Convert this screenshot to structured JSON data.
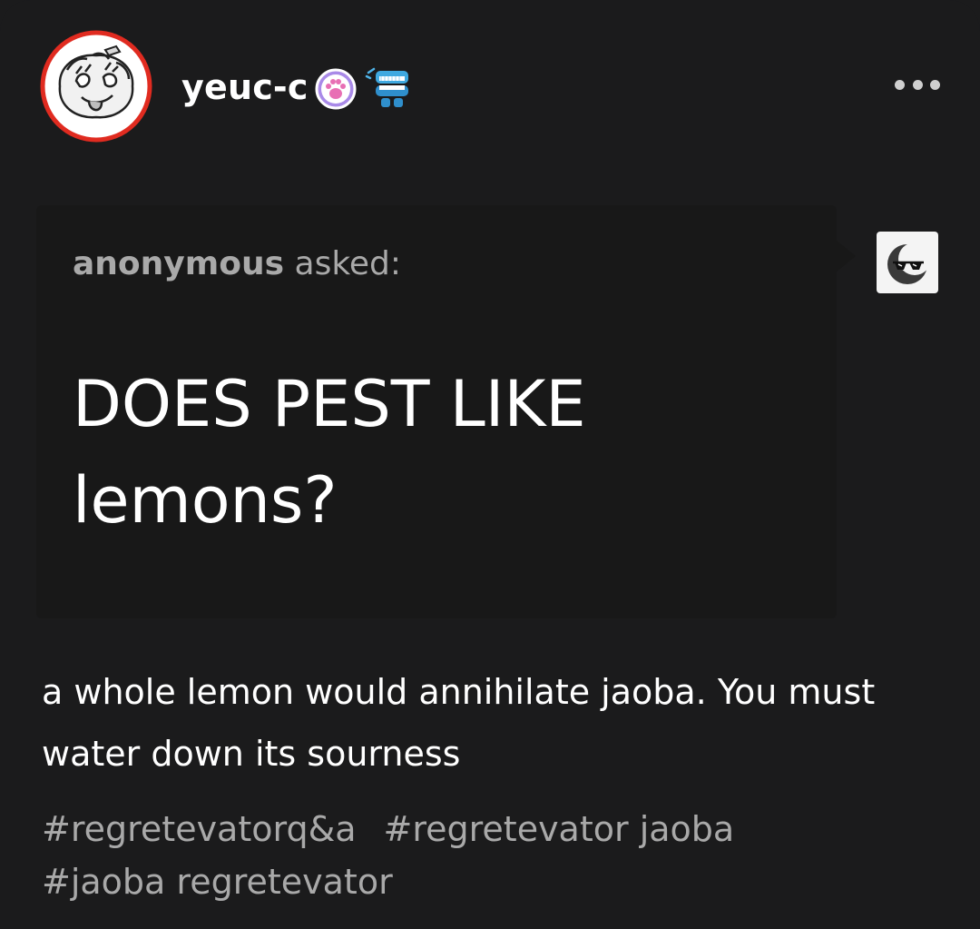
{
  "post": {
    "username": "yeuc-c",
    "colors": {
      "background": "#1b1b1c",
      "ask_box": "#181818",
      "avatar_ring": "#e02b20",
      "secondary_text": "#a9a9a9",
      "paw_badge": "#a98ae8"
    },
    "badges": [
      {
        "icon": "paw-badge-icon"
      },
      {
        "icon": "chattering-teeth-badge-icon"
      }
    ],
    "more_icon": "more-options-icon"
  },
  "ask": {
    "asker": "anonymous",
    "verb": "asked:",
    "question_line1": "DOES PEST LIKE",
    "question_line2": "lemons?"
  },
  "answer": {
    "line1": "a whole lemon would annihilate jaoba. You must",
    "line2": "water down its sourness"
  },
  "tags": [
    "#regretevatorq&a",
    "#regretevator jaoba",
    "#jaoba regretevator"
  ]
}
